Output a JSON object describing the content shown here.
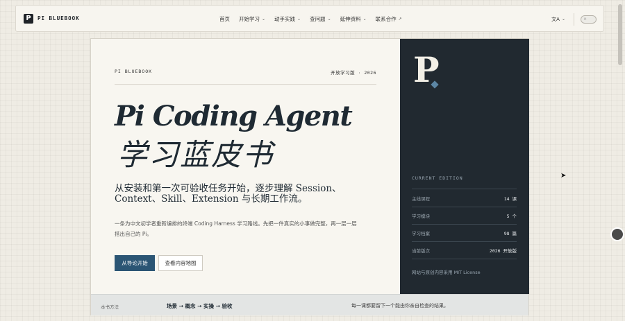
{
  "navbar": {
    "brand_logo": "P",
    "brand_name": "PI BLUEBOOK",
    "links": [
      {
        "label": "首页",
        "has_dropdown": false
      },
      {
        "label": "开始学习",
        "has_dropdown": true
      },
      {
        "label": "动手实践",
        "has_dropdown": true
      },
      {
        "label": "查问题",
        "has_dropdown": true
      },
      {
        "label": "延伸资料",
        "has_dropdown": true
      },
      {
        "label": "联系合作",
        "external": true
      }
    ],
    "chev": "⌄",
    "external_mark": "↗",
    "lang_icon": "文A",
    "theme_icon": "☼"
  },
  "hero": {
    "brand": "PI BLUEBOOK",
    "edition_tag": "开放学习版 · 2026",
    "title_en": "Pi Coding Agent",
    "title_zh": "学习蓝皮书",
    "subtitle": "从安装和第一次可验收任务开始，逐步理解 Session、Context、Skill、Extension 与长期工作流。",
    "description": "一条为中文初学者重新编排的终端 Coding Harness 学习路线。先把一件真实的小事做完整，再一层一层搭出自己的 Pi。",
    "primary_button": "从导论开始",
    "secondary_button": "查看内容地图"
  },
  "panel": {
    "logo_letter": "P",
    "edition_label": "CURRENT EDITION",
    "stats": [
      {
        "label": "主线课程",
        "value": "14 课"
      },
      {
        "label": "学习模块",
        "value": "5 个"
      },
      {
        "label": "学习档案",
        "value": "98 篇"
      },
      {
        "label": "当前版次",
        "value": "2026 开放版"
      }
    ],
    "license": "网站与原创内容采用 MIT License"
  },
  "method": {
    "label": "本书方法",
    "steps": "场景 → 概念 → 实操 → 验收",
    "note": "每一课都要留下一个能由你亲自检查的结果。"
  },
  "colors": {
    "accent": "#2b5574",
    "panel": "#212930",
    "background": "#efece4"
  }
}
